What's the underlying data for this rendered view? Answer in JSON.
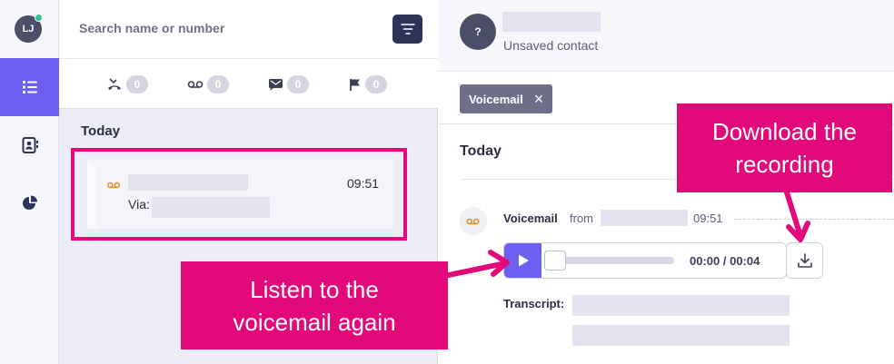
{
  "user": {
    "initials": "LJ"
  },
  "search": {
    "placeholder": "Search name or number"
  },
  "filters": {
    "missed": "0",
    "voicemail": "0",
    "messages": "0",
    "flagged": "0"
  },
  "list": {
    "section": "Today",
    "item": {
      "time": "09:51",
      "via_label": "Via:"
    }
  },
  "contact": {
    "avatar_glyph": "?",
    "status": "Unsaved contact"
  },
  "tag": {
    "label": "Voicemail",
    "remove_glyph": "×"
  },
  "thread": {
    "day": "Today",
    "voicemail_title": "Voicemail",
    "from_label": "from",
    "time": "09:51",
    "player_time": "00:00 / 00:04",
    "playback_progress": 0,
    "transcript_label": "Transcript:"
  },
  "callouts": {
    "download": "Download the\nrecording",
    "listen": "Listen to the\nvoicemail again"
  },
  "colors": {
    "accent": "#6d5ff0",
    "highlight": "#e2097a",
    "voicemail_icon": "#e8891c",
    "online": "#2fc28c"
  },
  "icons": {
    "rail": [
      "list-icon",
      "contacts-icon",
      "analytics-icon"
    ],
    "filters": [
      "missed-call-icon",
      "voicemail-icon",
      "message-icon",
      "flag-icon"
    ],
    "player": [
      "play-icon",
      "download-icon"
    ]
  }
}
